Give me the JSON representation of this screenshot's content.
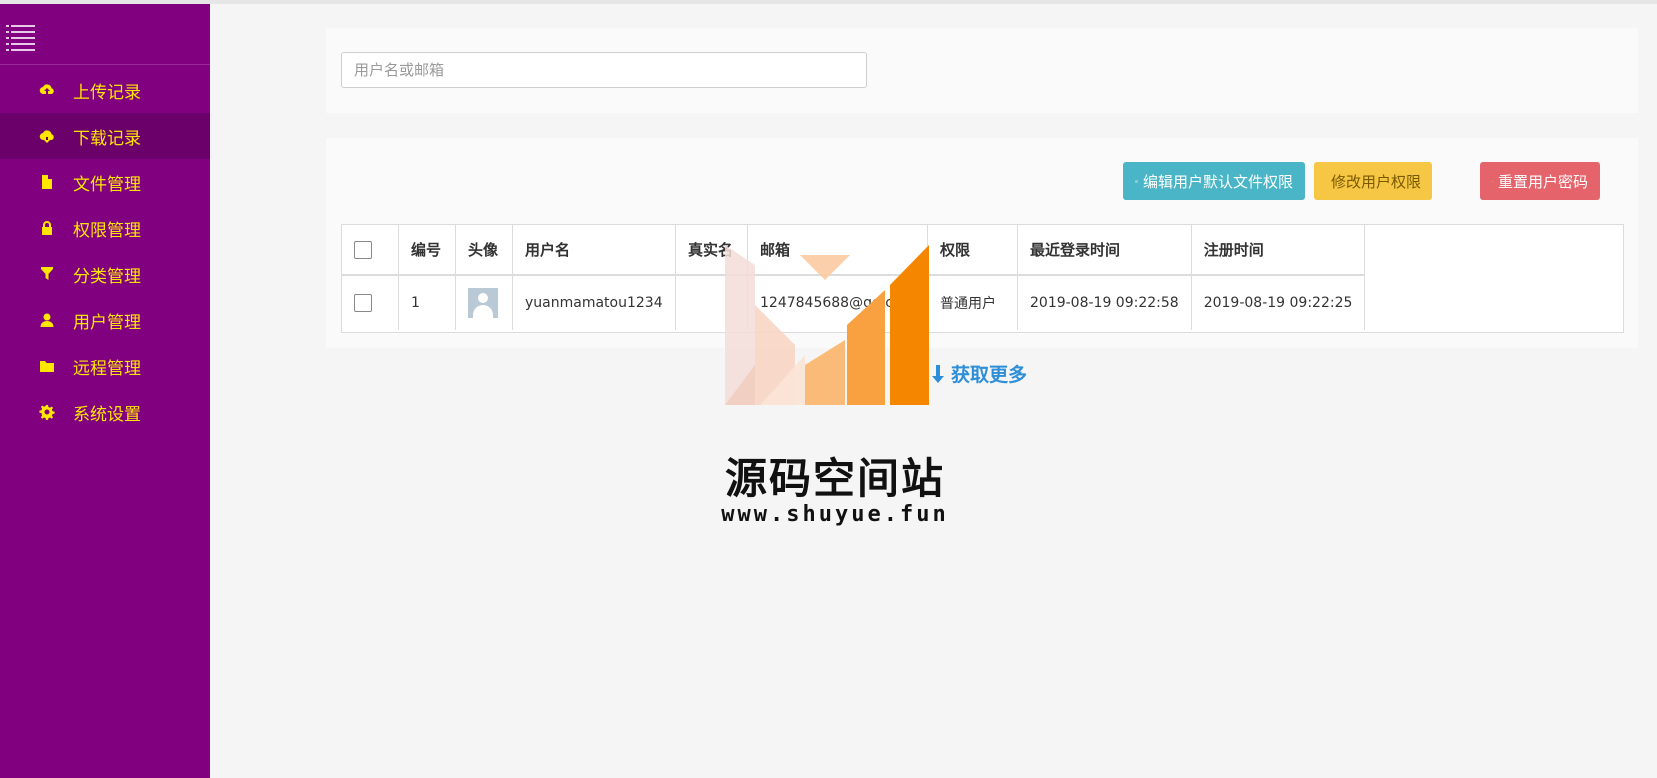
{
  "sidebar": {
    "items": [
      {
        "label": "上传记录",
        "icon": "cloud-upload-icon"
      },
      {
        "label": "下载记录",
        "icon": "cloud-download-icon"
      },
      {
        "label": "文件管理",
        "icon": "file-icon"
      },
      {
        "label": "权限管理",
        "icon": "lock-icon"
      },
      {
        "label": "分类管理",
        "icon": "filter-icon"
      },
      {
        "label": "用户管理",
        "icon": "user-icon"
      },
      {
        "label": "远程管理",
        "icon": "folder-icon"
      },
      {
        "label": "系统设置",
        "icon": "gear-icon"
      }
    ],
    "active_index": 1
  },
  "search": {
    "placeholder": "用户名或邮箱",
    "value": ""
  },
  "toolbar": {
    "edit_default_permission": "编辑用户默认文件权限",
    "modify_permission": "修改用户权限",
    "reset_password": "重置用户密码"
  },
  "table": {
    "headers": [
      "编号",
      "头像",
      "用户名",
      "真实名",
      "邮箱",
      "权限",
      "最近登录时间",
      "注册时间"
    ],
    "rows": [
      {
        "id": "1",
        "username": "yuanmamatou1234",
        "realname": "",
        "email": "1247845688@qq.co",
        "permission": "普通用户",
        "last_login": "2019-08-19 09:22:58",
        "registered": "2019-08-19 09:22:25"
      }
    ]
  },
  "load_more": "获取更多",
  "watermark": {
    "title": "源码空间站",
    "url": "www.shuyue.fun"
  },
  "colors": {
    "sidebar": "#800080",
    "sidebar_text": "#ffe600",
    "info": "#49b5c6",
    "warning": "#f6c744",
    "danger": "#e5646b",
    "link": "#2e8fd8"
  }
}
